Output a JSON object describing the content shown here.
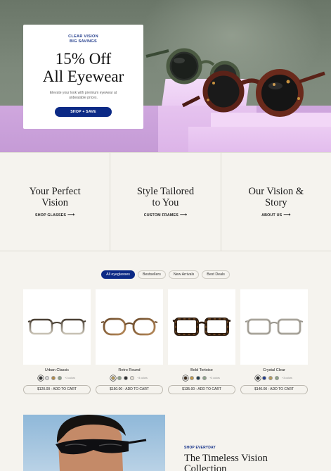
{
  "hero": {
    "eyebrow_line1": "CLEAR VISION",
    "eyebrow_line2": "BIG SAVINGS",
    "title_line1": "15% Off",
    "title_line2": "All Eyewear",
    "subtitle": "Elevate your look with premium eyewear at unbeatable prices.",
    "cta_label": "SHOP + SAVE"
  },
  "categories": [
    {
      "title_line1": "Your Perfect",
      "title_line2": "Vision",
      "link": "SHOP GLASSES"
    },
    {
      "title_line1": "Style Tailored",
      "title_line2": "to You",
      "link": "CUSTOM FRAMES"
    },
    {
      "title_line1": "Our Vision &",
      "title_line2": "Story",
      "link": "ABOUT US"
    }
  ],
  "filters": [
    "All eyeglasses",
    "Bestsellers",
    "New Arrivals",
    "Best Deals"
  ],
  "active_filter": "All eyeglasses",
  "products": [
    {
      "name": "Urban Classic",
      "more_colors": "+3 colors",
      "cta": "$120.00 - ADD TO CART",
      "swatches": [
        "#2b2b2b",
        "#d9d9d9",
        "#b08a4a",
        "#8fa38a"
      ]
    },
    {
      "name": "Retro Round",
      "more_colors": "+3 colors",
      "cta": "$150.00 - ADD TO CART",
      "swatches": [
        "#b59a5a",
        "#8fa38a",
        "#2b2b2b",
        "#e8e2d6"
      ]
    },
    {
      "name": "Bold Tortoise",
      "more_colors": "+3 colors",
      "cta": "$135.00 - ADD TO CART",
      "swatches": [
        "#3a2a1a",
        "#c29a4a",
        "#1f3a4a",
        "#8fa38a"
      ]
    },
    {
      "name": "Crystal Clear",
      "more_colors": "+3 colors",
      "cta": "$140.00 - ADD TO CART",
      "swatches": [
        "#2b2b2b",
        "#1f3a8a",
        "#b59a5a",
        "#8fa38a"
      ]
    }
  ],
  "feature": {
    "eyebrow": "SHOP EVERYDAY",
    "title": "The Timeless Vision Collection"
  },
  "colors": {
    "accent": "#0c2a86",
    "background": "#f5f3ee",
    "hero_pink": "#e8c6f1"
  }
}
